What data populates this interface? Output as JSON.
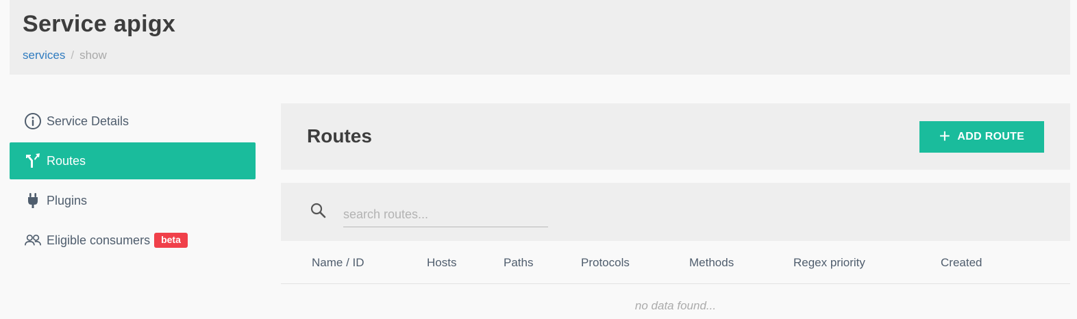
{
  "header": {
    "title": "Service apigx",
    "breadcrumb": {
      "link": "services",
      "separator": "/",
      "current": "show"
    }
  },
  "sidebar": {
    "items": [
      {
        "label": "Service Details",
        "icon": "info-circle-icon",
        "active": false
      },
      {
        "label": "Routes",
        "icon": "routes-icon",
        "active": true
      },
      {
        "label": "Plugins",
        "icon": "plug-icon",
        "active": false
      },
      {
        "label": "Eligible consumers",
        "icon": "users-icon",
        "active": false,
        "badge": "beta"
      }
    ]
  },
  "routes": {
    "title": "Routes",
    "add_button_label": "ADD ROUTE",
    "search": {
      "placeholder": "search routes...",
      "value": ""
    },
    "table": {
      "columns": [
        "Name / ID",
        "Hosts",
        "Paths",
        "Protocols",
        "Methods",
        "Regex priority",
        "Created"
      ],
      "empty_text": "no data found..."
    }
  },
  "colors": {
    "accent": "#1abc9c",
    "link": "#2f7bbf",
    "badge": "#f0404a",
    "panel": "#eeeeee",
    "background": "#f9f9f9"
  }
}
